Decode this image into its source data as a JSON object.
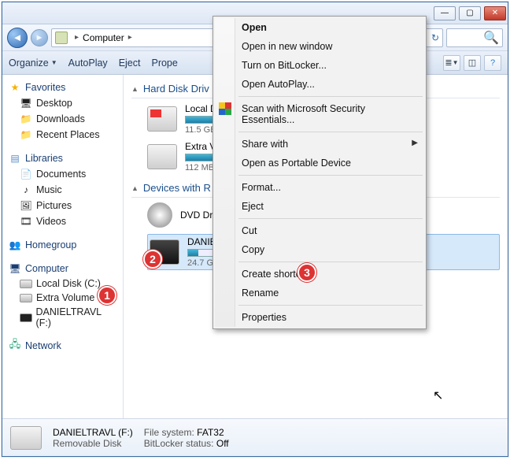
{
  "titlebar": {
    "min": "—",
    "max": "▢",
    "close": "✕"
  },
  "address": {
    "root": "Computer",
    "chev": "▸",
    "refresh": "↻",
    "search_icon": "🔍"
  },
  "toolbar": {
    "organize": "Organize",
    "autoplay": "AutoPlay",
    "eject": "Eject",
    "properties": "Prope"
  },
  "nav": {
    "favorites": "Favorites",
    "fav_items": [
      "Desktop",
      "Downloads",
      "Recent Places"
    ],
    "libraries": "Libraries",
    "lib_items": [
      "Documents",
      "Music",
      "Pictures",
      "Videos"
    ],
    "homegroup": "Homegroup",
    "computer": "Computer",
    "comp_items": [
      "Local Disk (C:)",
      "Extra Volume (E:)",
      "DANIELTRAVL (F:)"
    ],
    "network": "Network"
  },
  "sections": {
    "hdd": "Hard Disk Driv",
    "devices": "Devices with R"
  },
  "drives": {
    "c": {
      "name": "Local Di",
      "sub": "11.5 GB"
    },
    "e": {
      "name": "Extra Vo",
      "sub": "112 MB"
    },
    "dvd": {
      "name": "DVD Dri"
    },
    "usb": {
      "name": "DANIEL",
      "sub": "24.7 GB"
    }
  },
  "context": {
    "open": "Open",
    "open_new": "Open in new window",
    "bitlocker": "Turn on BitLocker...",
    "autoplay": "Open AutoPlay...",
    "scan": "Scan with Microsoft Security Essentials...",
    "share": "Share with",
    "portable": "Open as Portable Device",
    "format": "Format...",
    "eject": "Eject",
    "cut": "Cut",
    "copy": "Copy",
    "shortcut": "Create shortcut",
    "rename": "Rename",
    "properties": "Properties"
  },
  "status": {
    "name": "DANIELTRAVL (F:)",
    "type": "Removable Disk",
    "fs_label": "File system:",
    "fs_value": "FAT32",
    "bl_label": "BitLocker status:",
    "bl_value": "Off"
  },
  "anno": {
    "a1": "1",
    "a2": "2",
    "a3": "3"
  }
}
